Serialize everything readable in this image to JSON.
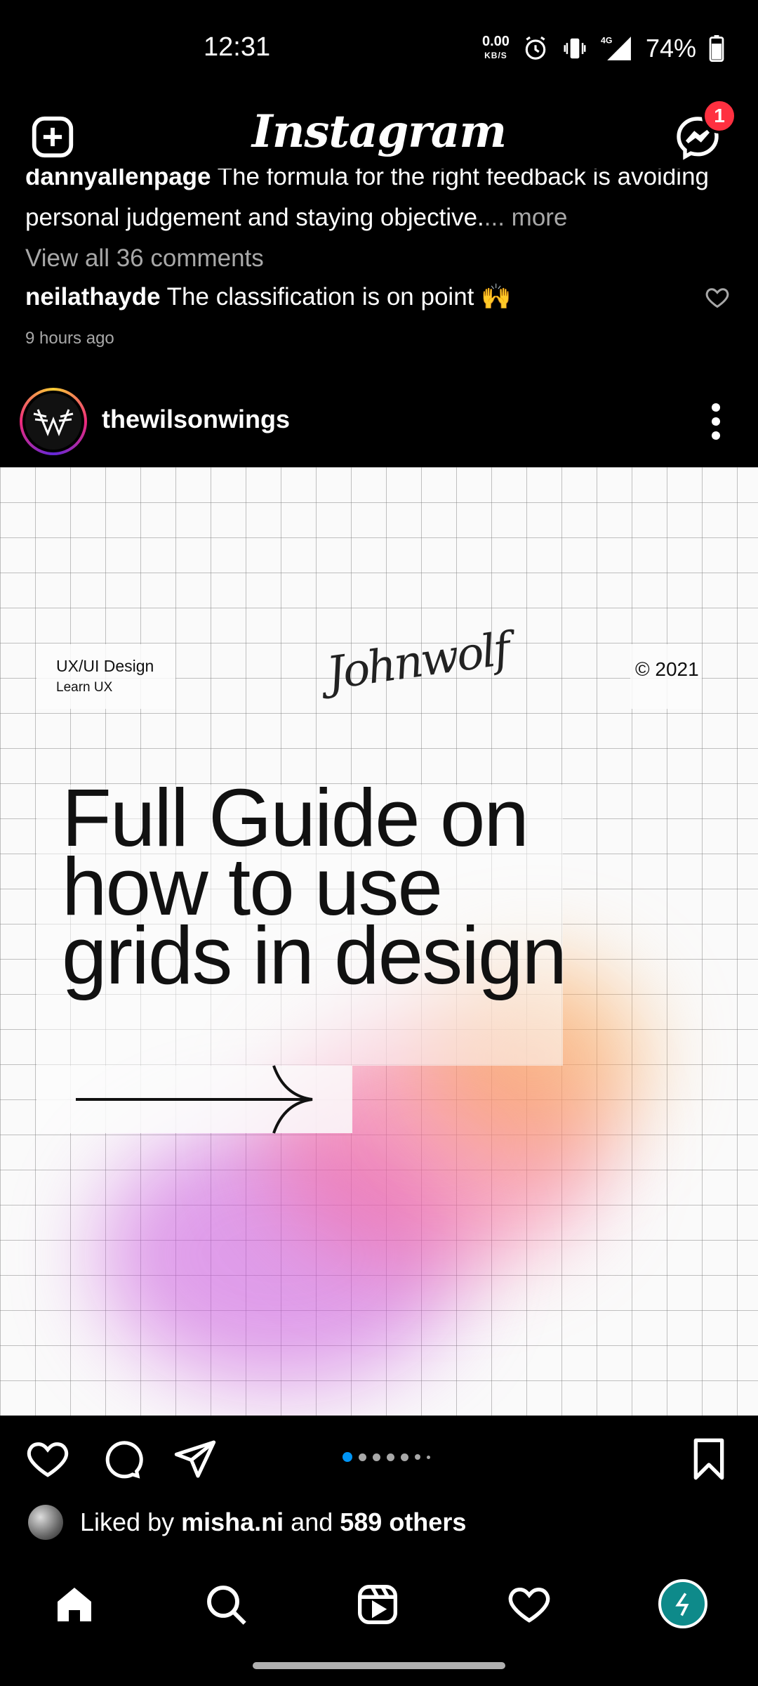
{
  "status_bar": {
    "time": "12:31",
    "net_speed": "0.00",
    "net_unit": "KB/S",
    "network": "4G",
    "battery": "74%"
  },
  "header": {
    "logo": "Instagram",
    "messages_badge": "1"
  },
  "prev_post": {
    "cropped_comment_user": "dannyallenpage",
    "cropped_comment_text": "The formula for the right feedback is avoiding",
    "comment_line2": "personal judgement and staying objective.",
    "more_label": "... more",
    "view_all": "View all 36 comments",
    "comment_user": "neilathayde",
    "comment_text": "The classification is on point 🙌",
    "timestamp": "9 hours ago"
  },
  "post": {
    "username": "thewilsonwings",
    "image": {
      "tag_title": "UX/UI Design",
      "tag_subtitle": "Learn UX",
      "signature": "Johnwolf",
      "year": "© 2021",
      "headline_1": "Full Guide on",
      "headline_2": "how to use",
      "headline_3": "grids in design"
    },
    "carousel": {
      "count": 7,
      "active_index": 0
    },
    "likes": {
      "prefix": "Liked by",
      "user": "misha.ni",
      "middle": "and",
      "others": "589 others"
    }
  },
  "bottom_nav": [
    "home-icon",
    "search-icon",
    "reels-icon",
    "activity-heart-icon",
    "profile-avatar"
  ],
  "colors": {
    "background": "#000000",
    "accent_blue": "#0095f6",
    "badge_red": "#ff3040",
    "muted_text": "#a8a8a8"
  }
}
